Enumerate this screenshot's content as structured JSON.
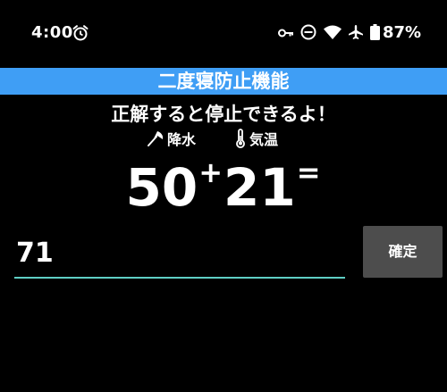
{
  "status_bar": {
    "time": "4:00",
    "battery": "87%",
    "icons": [
      "alarm-icon",
      "key-icon",
      "do-not-disturb-icon",
      "wifi-icon",
      "airplane-icon",
      "battery-icon"
    ]
  },
  "app": {
    "title": "二度寝防止機能",
    "instruction": "正解すると停止できるよ！",
    "accent_color": "#3f9ef5"
  },
  "weather": {
    "precipitation_label": "降水",
    "precipitation_icon": "umbrella-icon",
    "temperature_label": "気温",
    "temperature_icon": "thermometer-icon"
  },
  "problem": {
    "operand_1": "50",
    "operator": "+",
    "operand_2": "21",
    "equals": "="
  },
  "answer": {
    "value": "71",
    "underline_color": "#5ecec4"
  },
  "buttons": {
    "confirm_label": "確定"
  }
}
